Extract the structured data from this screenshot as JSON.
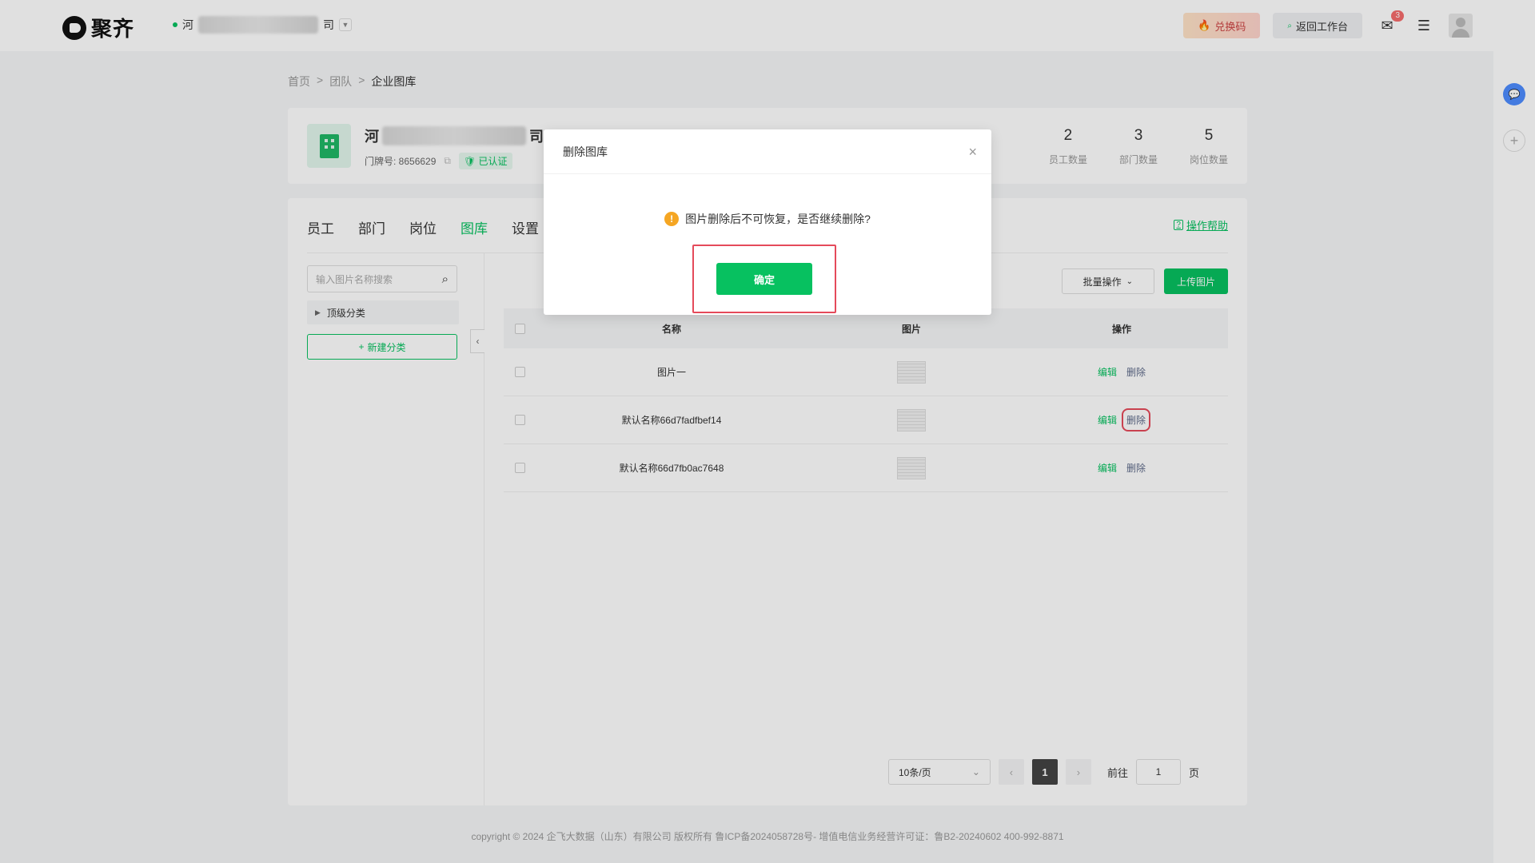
{
  "app": {
    "logo_text": "聚齐"
  },
  "header": {
    "org_prefix": "河",
    "org_suffix": "司",
    "redeem_label": "兑换码",
    "return_label": "返回工作台",
    "mail_badge": "3"
  },
  "breadcrumb": {
    "home": "首页",
    "team": "团队",
    "current": "企业图库",
    "sep": ">"
  },
  "org": {
    "name_prefix": "河",
    "name_suffix": "司",
    "house_number_label": "门牌号: 8656629",
    "verified_label": "已认证",
    "stats": [
      {
        "value": "2",
        "label": "员工数量"
      },
      {
        "value": "3",
        "label": "部门数量"
      },
      {
        "value": "5",
        "label": "岗位数量"
      }
    ]
  },
  "tabs": [
    {
      "label": "员工"
    },
    {
      "label": "部门"
    },
    {
      "label": "岗位"
    },
    {
      "label": "图库"
    },
    {
      "label": "设置"
    }
  ],
  "help_label": "操作帮助",
  "sidebar": {
    "search_placeholder": "输入图片名称搜索",
    "tree_root": "顶级分类",
    "new_category": "新建分类"
  },
  "toolbar": {
    "batch_label": "批量操作",
    "upload_label": "上传图片"
  },
  "table": {
    "headers": {
      "name": "名称",
      "image": "图片",
      "ops": "操作"
    },
    "rows": [
      {
        "name": "图片一",
        "edit": "编辑",
        "delete": "删除"
      },
      {
        "name": "默认名称66d7fadfbef14",
        "edit": "编辑",
        "delete": "删除"
      },
      {
        "name": "默认名称66d7fb0ac7648",
        "edit": "编辑",
        "delete": "删除"
      }
    ]
  },
  "pagination": {
    "page_size": "10条/页",
    "current_page": "1",
    "goto_label": "前往",
    "goto_value": "1",
    "page_unit": "页"
  },
  "footer": {
    "text": "copyright © 2024 企飞大数据（山东）有限公司 版权所有 鲁ICP备2024058728号- 增值电信业务经营许可证：鲁B2-20240602 400-992-8871"
  },
  "modal": {
    "title": "删除图库",
    "message": "图片删除后不可恢复，是否继续删除?",
    "confirm_label": "确定"
  },
  "colors": {
    "accent": "#07c160",
    "danger": "#e54a5a",
    "warning": "#f5a623"
  }
}
